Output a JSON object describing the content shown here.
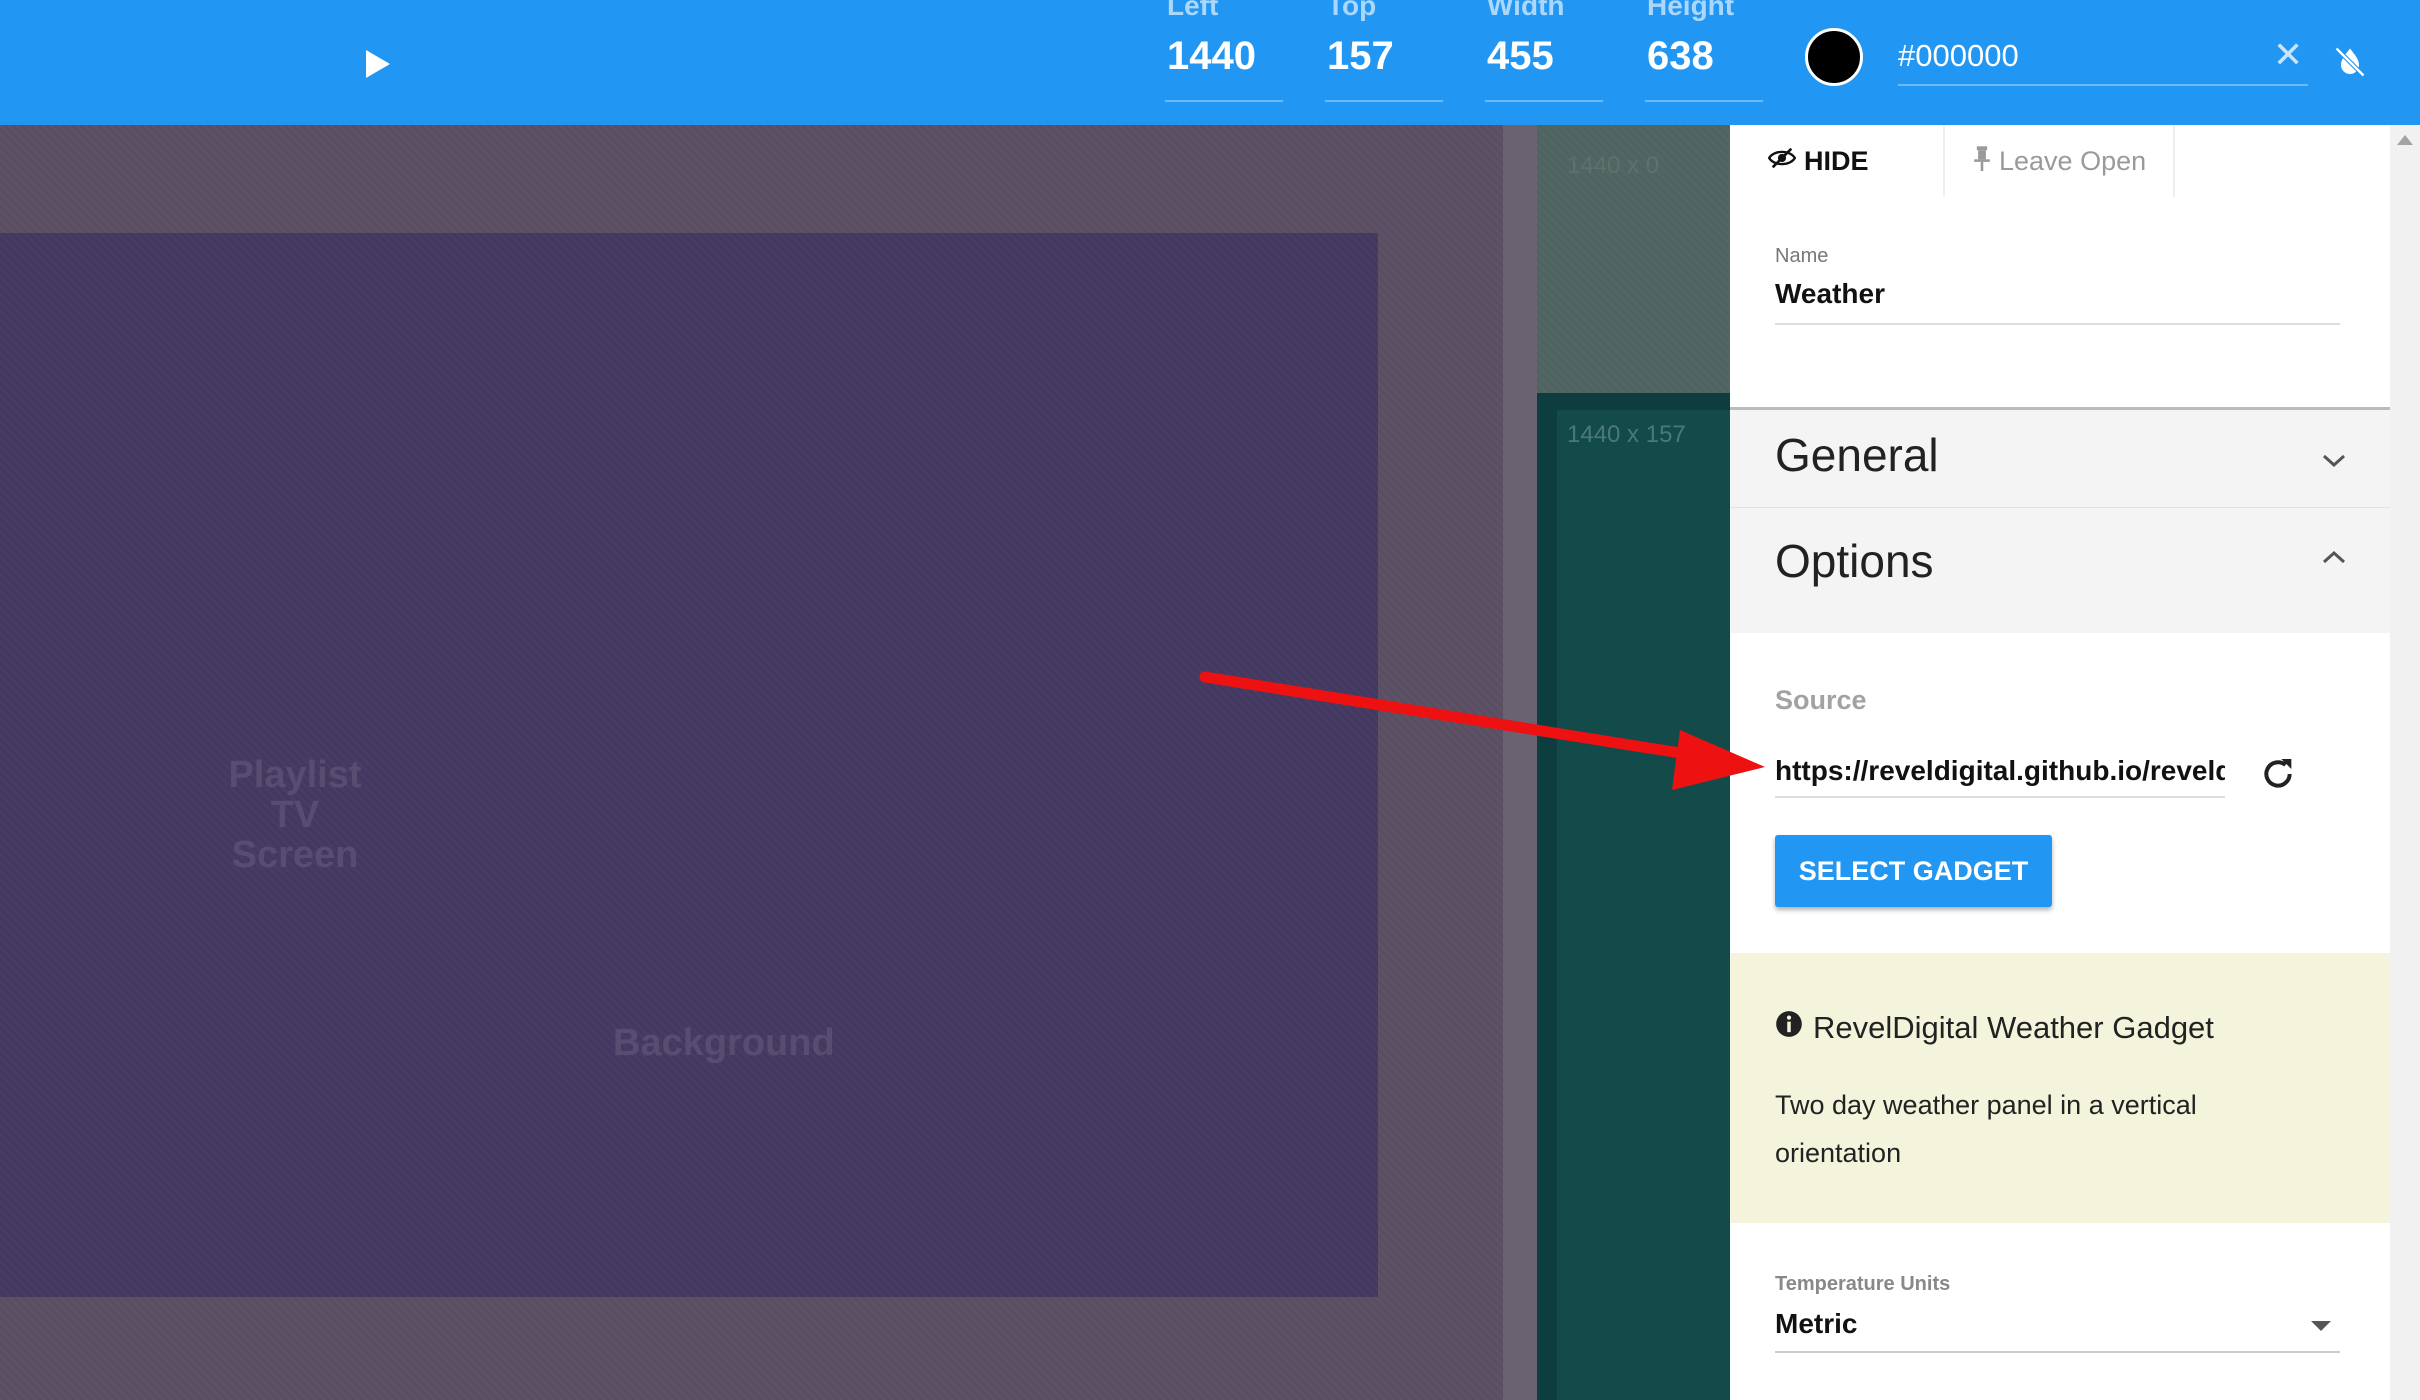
{
  "toolbar": {
    "fields": [
      {
        "label": "Left",
        "value": "1440"
      },
      {
        "label": "Top",
        "value": "157"
      },
      {
        "label": "Width",
        "value": "455"
      },
      {
        "label": "Height",
        "value": "638"
      }
    ],
    "color_swatch": "#000000",
    "color_value": "#000000",
    "clear_glyph": "✕"
  },
  "canvas": {
    "playlist_label": "Playlist",
    "playlist_sublabel": "TV Screen",
    "background_label": "Background",
    "zone1_label": "1440 x 0",
    "zone2_label": "1440 x 157"
  },
  "panel": {
    "tabs": {
      "hide": "HIDE",
      "leave_open": "Leave Open"
    },
    "name_label": "Name",
    "name_value": "Weather",
    "general_title": "General",
    "options_title": "Options",
    "source_label": "Source",
    "source_value": "https://reveldigital.github.io/reveldigital-gadgets/weather",
    "select_gadget": "SELECT GADGET",
    "info_title": "RevelDigital Weather Gadget",
    "info_desc": "Two day weather panel in a vertical orientation",
    "temp_label": "Temperature Units",
    "temp_value": "Metric"
  },
  "icons": [
    "play-icon",
    "invert-colors-off-icon",
    "eye-slash-icon",
    "pin-icon",
    "chevron-down-icon",
    "chevron-up-icon",
    "refresh-icon",
    "info-icon",
    "dropdown-caret-icon",
    "red-arrow"
  ],
  "colors": {
    "toolbar": "#2196f3",
    "button": "#2196f3",
    "info_bg": "#f4f4dc",
    "arrow": "#ee1111"
  }
}
